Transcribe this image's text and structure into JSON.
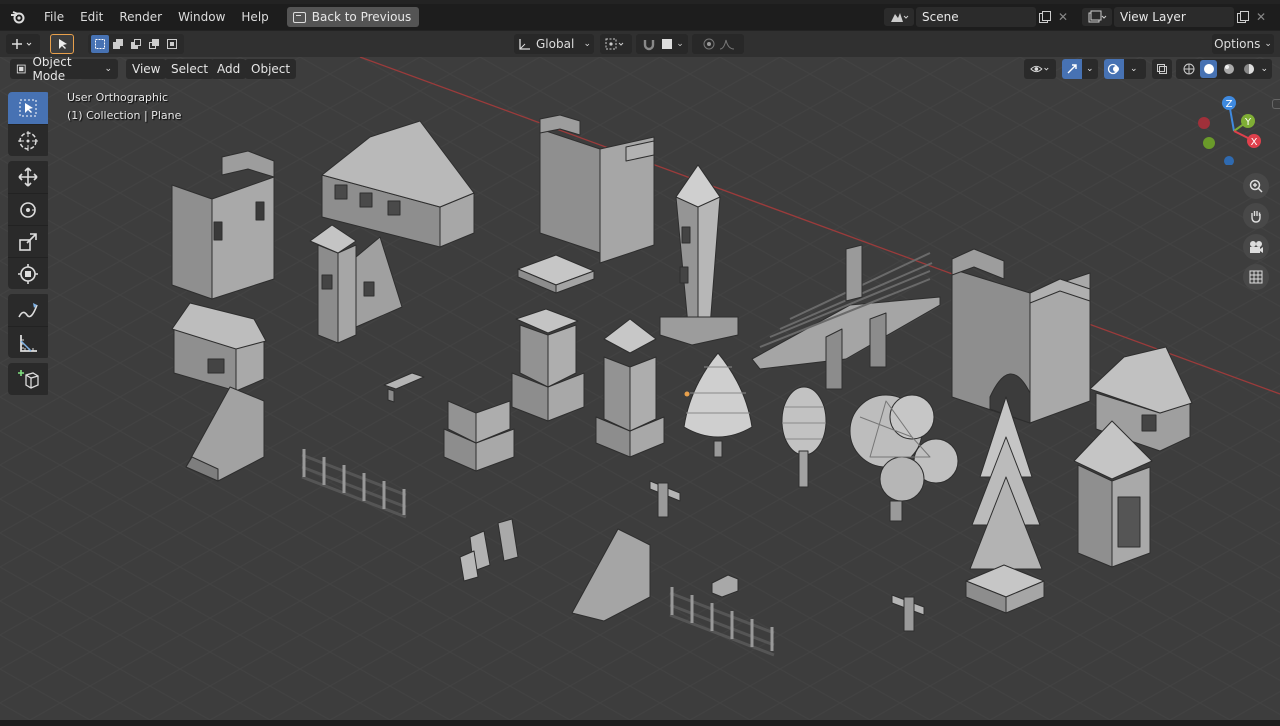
{
  "topbar": {
    "menus": [
      "File",
      "Edit",
      "Render",
      "Window",
      "Help"
    ],
    "back_button": "Back to Previous",
    "scene_label": "Scene",
    "view_layer_label": "View Layer"
  },
  "tool_header": {
    "transform_orientation": "Global",
    "options_label": "Options"
  },
  "viewport_header": {
    "mode": "Object Mode",
    "menus": [
      "View",
      "Select",
      "Add",
      "Object"
    ]
  },
  "viewport": {
    "view_name": "User Orthographic",
    "collection_info": "(1) Collection | Plane"
  },
  "gizmo": {
    "axis_z": "Z",
    "axis_y": "Y",
    "axis_x": "X",
    "colors": {
      "x": "#e0404c",
      "y": "#7fae35",
      "z": "#3f8ae0"
    }
  },
  "icons": {
    "tools": [
      "select-box-icon",
      "cursor-icon",
      "move-icon",
      "rotate-icon",
      "scale-icon",
      "transform-icon",
      "annotate-icon",
      "measure-icon",
      "add-cube-icon"
    ],
    "nav": [
      "zoom-icon",
      "pan-hand-icon",
      "camera-icon",
      "grid-icon"
    ]
  },
  "colors": {
    "accent": "#4772b3",
    "viewport_bg": "#3c3c3c",
    "x_axis_line": "#b43c3c"
  }
}
